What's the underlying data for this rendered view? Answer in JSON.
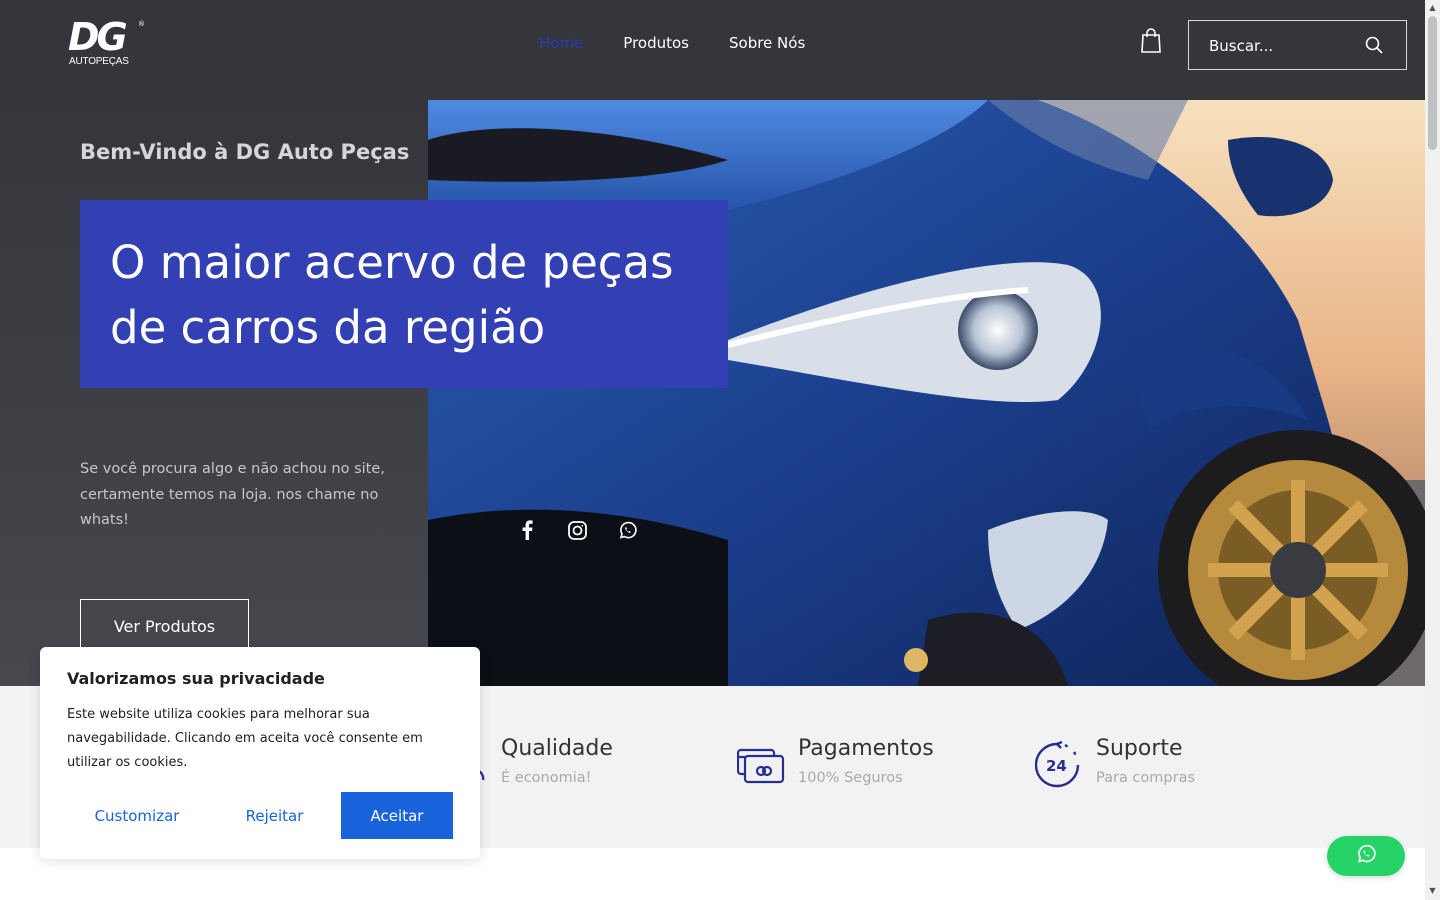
{
  "brand": {
    "logo_main": "DG",
    "logo_sub": "AUTOPEÇAS",
    "logo_reg": "®"
  },
  "nav": {
    "items": [
      {
        "label": "Home",
        "active": true
      },
      {
        "label": "Produtos",
        "active": false
      },
      {
        "label": "Sobre Nós",
        "active": false
      }
    ]
  },
  "header": {
    "cart_icon": "shopping-bag-icon"
  },
  "search": {
    "placeholder": "Buscar...",
    "icon": "search-icon"
  },
  "hero": {
    "welcome": "Bem-Vindo à DG Auto Peças",
    "headline_line1": "O maior acervo de peças",
    "headline_line2": "de carros da região",
    "description": "Se você procura algo e não achou no site, certamente temos na loja. nos chame no whats!",
    "cta_label": "Ver Produtos",
    "social": [
      "facebook-icon",
      "instagram-icon",
      "whatsapp-icon"
    ]
  },
  "features": [
    {
      "title": "Qualidade",
      "subtitle": "É economia!",
      "icon": "quality-icon"
    },
    {
      "title": "Pagamentos",
      "subtitle": "100% Seguros",
      "icon": "payment-cards-icon"
    },
    {
      "title": "Suporte",
      "subtitle": "Para compras",
      "icon": "support-24h-icon"
    }
  ],
  "cookie": {
    "title": "Valorizamos sua privacidade",
    "text": "Este website utiliza cookies para melhorar sua navegabilidade. Clicando em aceita você consente em utilizar os cookies.",
    "customize_label": "Customizar",
    "reject_label": "Rejeitar",
    "accept_label": "Aceitar"
  },
  "floating_whatsapp": {
    "icon": "whatsapp-icon"
  },
  "colors": {
    "header_bg": "#34363b",
    "accent_blue": "#3340b3",
    "nav_active": "#2b3bb4",
    "cookie_blue": "#1863dc",
    "whatsapp_green": "#25d366",
    "feature_bg": "#f2f2f2"
  }
}
